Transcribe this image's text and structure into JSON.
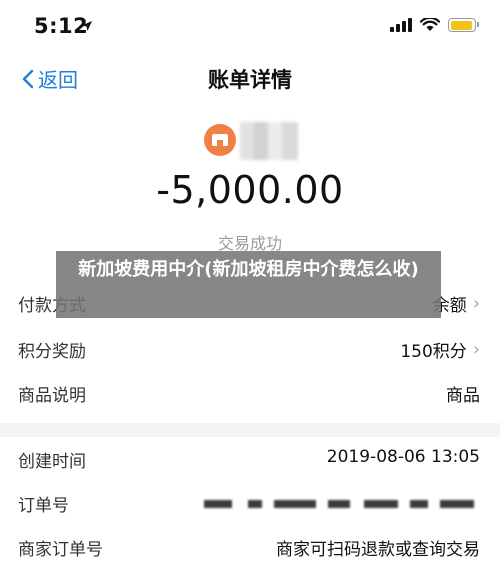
{
  "status_bar": {
    "time": "5:12",
    "location_icon": "location-arrow-icon",
    "signal_icon": "cellular-signal-icon",
    "wifi_icon": "wifi-icon",
    "battery_icon": "battery-icon",
    "battery_color": "#f2c21b"
  },
  "nav": {
    "back_label": "返回",
    "title": "账单详情",
    "accent_color": "#1f7ed8"
  },
  "bill": {
    "merchant_icon": "store-icon",
    "merchant_icon_color": "#f08044",
    "amount": "-5,000.00",
    "status": "交易成功"
  },
  "overlay": {
    "text": "新加坡费用中介(新加坡租房中介费怎么收)"
  },
  "details": [
    {
      "label": "付款方式",
      "value": "余额"
    },
    {
      "label": "积分奖励",
      "value": "150积分"
    },
    {
      "label": "商品说明",
      "value": "商品"
    },
    {
      "label": "创建时间",
      "value": "2019-08-06 13:05"
    },
    {
      "label": "订单号",
      "value": ""
    },
    {
      "label": "商家订单号",
      "value": "商家可扫码退款或查询交易"
    }
  ]
}
